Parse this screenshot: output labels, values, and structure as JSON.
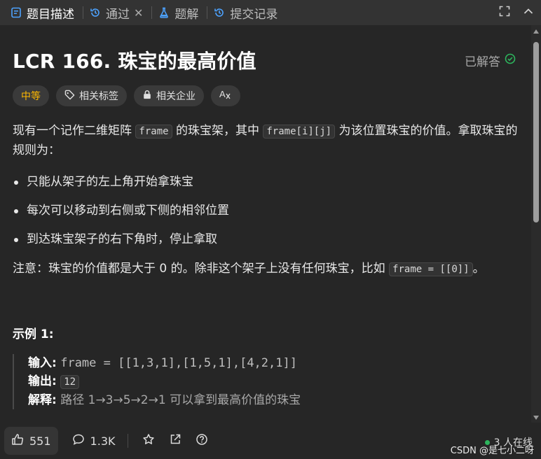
{
  "tabs": [
    {
      "label": "题目描述"
    },
    {
      "label": "通过"
    },
    {
      "label": "题解"
    },
    {
      "label": "提交记录"
    }
  ],
  "problem": {
    "title": "LCR 166. 珠宝的最高价值",
    "status": "已解答"
  },
  "tags": {
    "difficulty": "中等",
    "related_tags": "相关标签",
    "related_companies": "相关企业",
    "translate": "A文"
  },
  "description": {
    "p1_a": "现有一个记作二维矩阵 ",
    "p1_code1": "frame",
    "p1_b": " 的珠宝架，其中 ",
    "p1_code2": "frame[i][j]",
    "p1_c": " 为该位置珠宝的价值。拿取珠宝的规则为：",
    "rules": [
      "只能从架子的左上角开始拿珠宝",
      "每次可以移动到右侧或下侧的相邻位置",
      "到达珠宝架子的右下角时，停止拿取"
    ],
    "note_a": "注意：珠宝的价值都是大于 0 的。除非这个架子上没有任何珠宝，比如 ",
    "note_code": "frame = [[0]]",
    "note_b": "。"
  },
  "example": {
    "heading": "示例 1:",
    "input_label": "输入:",
    "input_value": "frame = [[1,3,1],[1,5,1],[4,2,1]]",
    "output_label": "输出:",
    "output_value": "12",
    "explain_label": "解释:",
    "explain_value": "路径 1→3→5→2→1 可以拿到最高价值的珠宝"
  },
  "bottom": {
    "likes": "551",
    "comments": "1.3K",
    "online": "3 人在线"
  },
  "watermark": "CSDN @是七小二呀",
  "colors": {
    "background": "#262626",
    "tabbar": "#333333",
    "difficulty": "#ffb800",
    "solved_check": "#2db55d",
    "online_dot": "#2db55d"
  }
}
